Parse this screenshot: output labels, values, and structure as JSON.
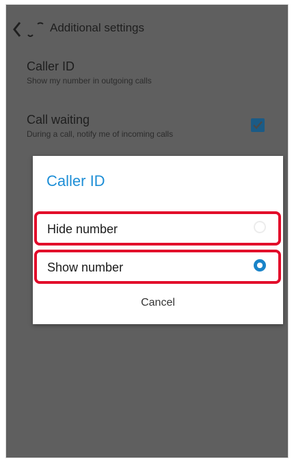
{
  "header": {
    "title": "Additional settings"
  },
  "settings": [
    {
      "title": "Caller ID",
      "summary": "Show my number in outgoing calls"
    },
    {
      "title": "Call waiting",
      "summary": "During a call, notify me of incoming calls",
      "checked": true
    }
  ],
  "dialog": {
    "title": "Caller ID",
    "options": [
      {
        "label": "Hide number",
        "selected": false
      },
      {
        "label": "Show number",
        "selected": true
      }
    ],
    "cancel_label": "Cancel"
  },
  "colors": {
    "dim_background": "#5f5f5f",
    "accent": "#1d8ed6",
    "highlight_border": "#e20a2a"
  },
  "icons": {
    "back": "back-arrow-icon",
    "checkbox": "checkbox-checked-icon"
  }
}
